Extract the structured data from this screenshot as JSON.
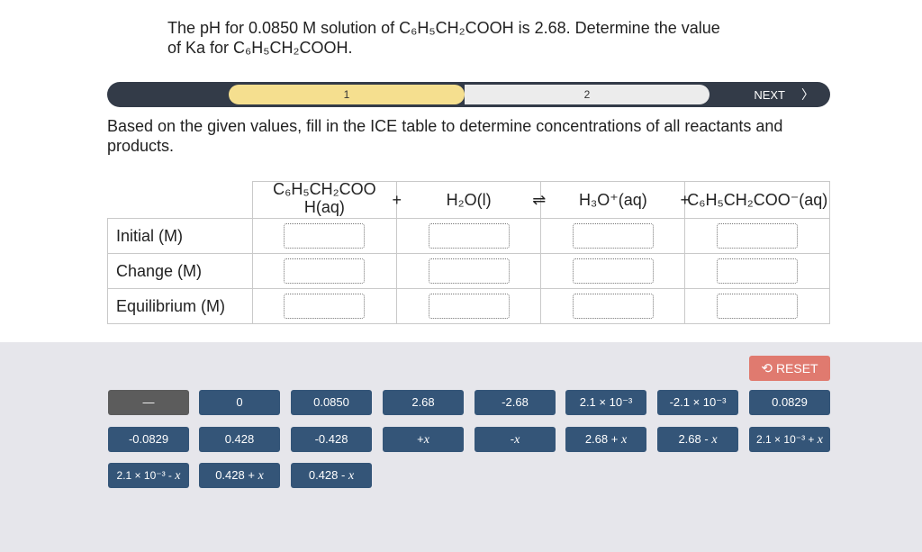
{
  "question": {
    "line1": "The pH for 0.0850 M solution of C₆H₅CH₂COOH is 2.68. Determine the value",
    "line2": "of Ka for C₆H₅CH₂COOH."
  },
  "progress": {
    "step1": "1",
    "step2": "2",
    "next": "NEXT",
    "colors": {
      "bar": "#333b48",
      "active": "#f5df8f",
      "inactive": "#ececec"
    }
  },
  "instruction": "Based on the given values, fill in the ICE table to determine concentrations of all reactants and products.",
  "ice": {
    "headers": {
      "reactant1": "C₆H₅CH₂COOH(aq)",
      "plus1": "+",
      "reactant2": "H₂O(l)",
      "arrow": "⇌",
      "product1": "H₃O⁺(aq)",
      "plus2": "+",
      "product2": "C₆H₅CH₂COO⁻(aq)"
    },
    "rows": [
      "Initial (M)",
      "Change (M)",
      "Equilibrium (M)"
    ]
  },
  "bank": {
    "reset": "RESET",
    "tiles": [
      "—",
      "0",
      "0.0850",
      "2.68",
      "-2.68",
      "2.1 × 10⁻³",
      "-2.1 × 10⁻³",
      "0.0829",
      "-0.0829",
      "0.428",
      "-0.428",
      "+",
      "-",
      "2.68 + ",
      "2.68 - ",
      "2.1 × 10⁻³ + ",
      "2.1 × 10⁻³ - ",
      "0.428 + ",
      "0.428 - "
    ],
    "variable": "x",
    "colors": {
      "tile": "#345578",
      "tile_used": "#5c5c5c",
      "reset": "#e07a6f",
      "background": "#e6e6eb"
    }
  }
}
